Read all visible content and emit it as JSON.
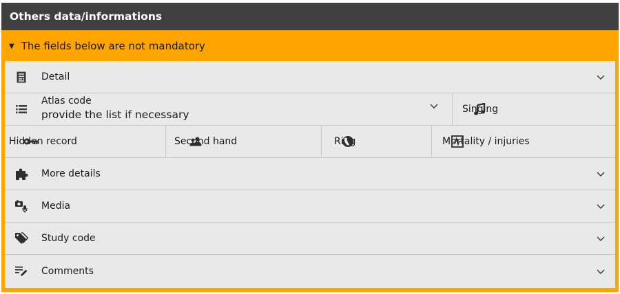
{
  "header": {
    "title": "Others data/informations"
  },
  "notice": {
    "text": "The fields below are not mandatory"
  },
  "rows": {
    "detail": {
      "label": "Detail"
    },
    "atlas": {
      "label": "Atlas code",
      "value": "provide the list if necessary"
    },
    "singing": {
      "label": "Singing"
    },
    "hidden_record": {
      "label": "Hidden record"
    },
    "second_hand": {
      "label": "Second hand"
    },
    "ring": {
      "label": "Ring"
    },
    "mortality": {
      "label": "Mortality / injuries"
    },
    "more_details": {
      "label": "More details"
    },
    "media": {
      "label": "Media"
    },
    "study_code": {
      "label": "Study code"
    },
    "comments": {
      "label": "Comments"
    }
  },
  "colors": {
    "header_bg": "#3f3f3f",
    "accent": "#ffa500",
    "row_bg": "#e9e9e9",
    "divider": "#c9c9c9"
  }
}
